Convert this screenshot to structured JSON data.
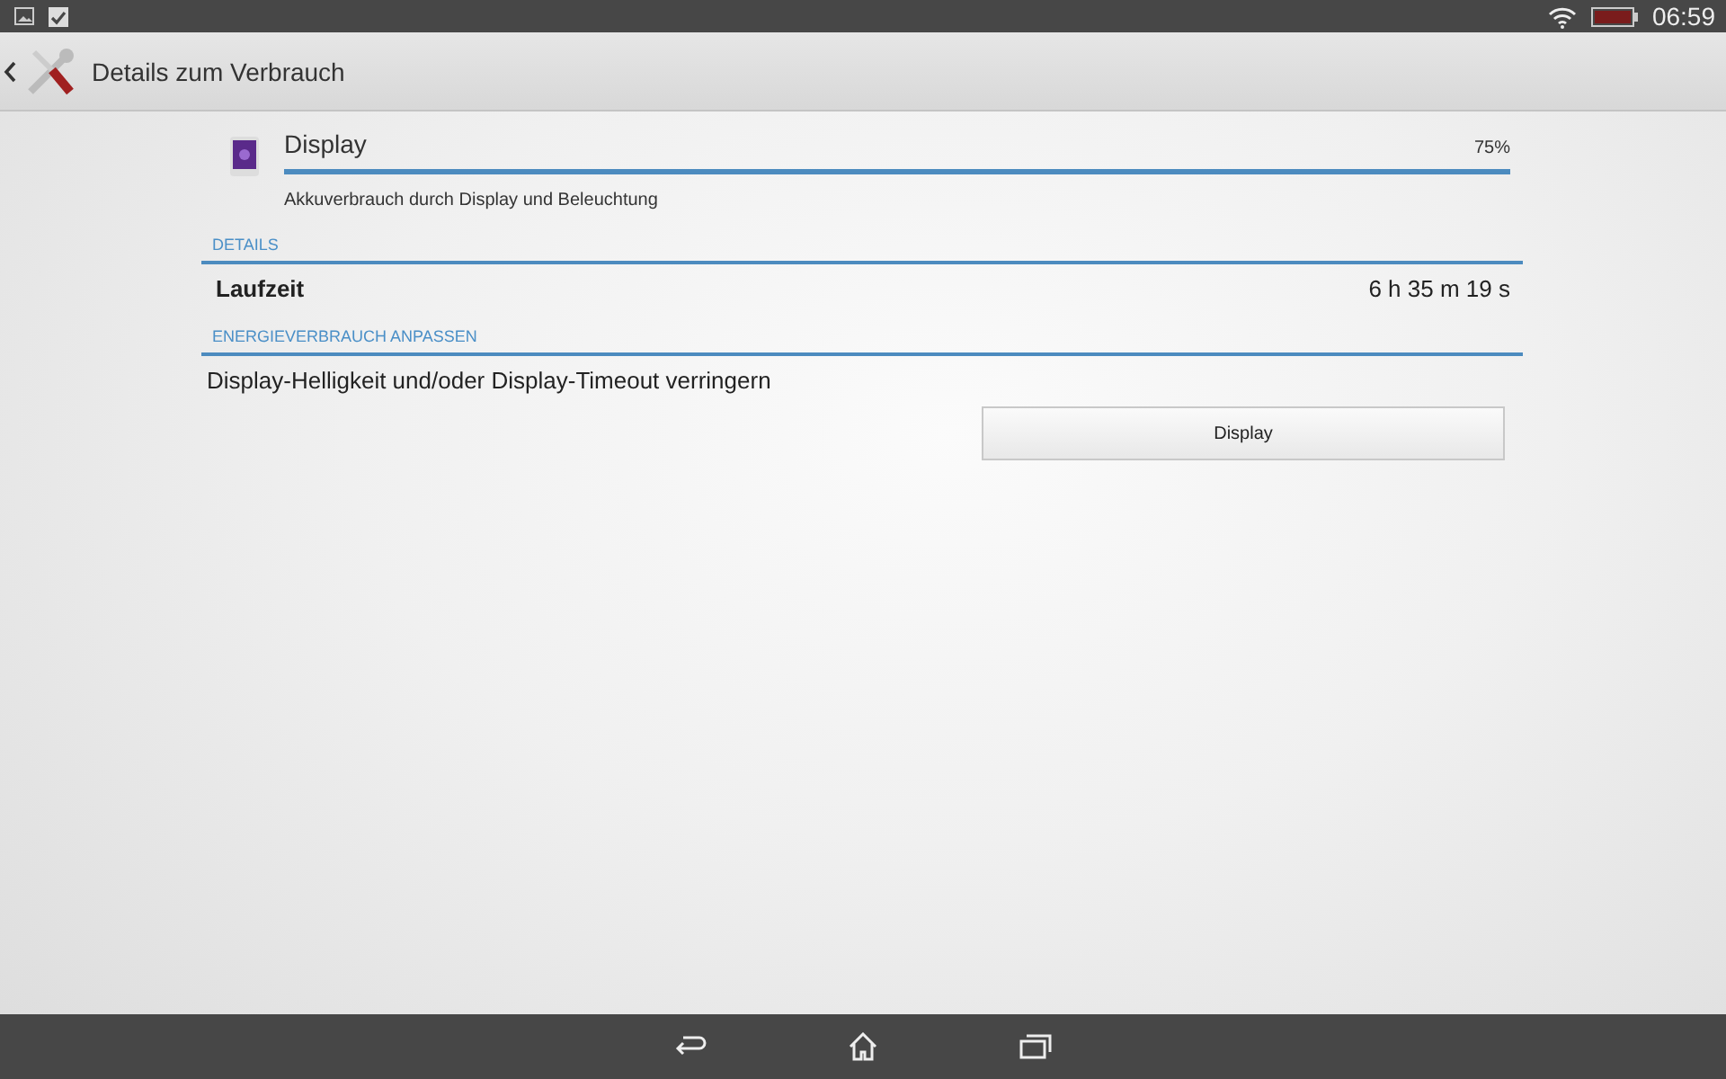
{
  "status_bar": {
    "time": "06:59"
  },
  "action_bar": {
    "title": "Details zum Verbrauch"
  },
  "usage": {
    "name": "Display",
    "percent": "75%",
    "level": 1,
    "description": "Akkuverbrauch durch Display und Beleuchtung"
  },
  "sections": [
    {
      "heading": "DETAILS",
      "rows": [
        {
          "label": "Laufzeit",
          "value": "6 h 35 m 19 s"
        }
      ]
    },
    {
      "heading": "ENERGIEVERBRAUCH ANPASSEN",
      "text": "Display-Helligkeit und/oder Display-Timeout verringern",
      "button": "Display"
    }
  ]
}
